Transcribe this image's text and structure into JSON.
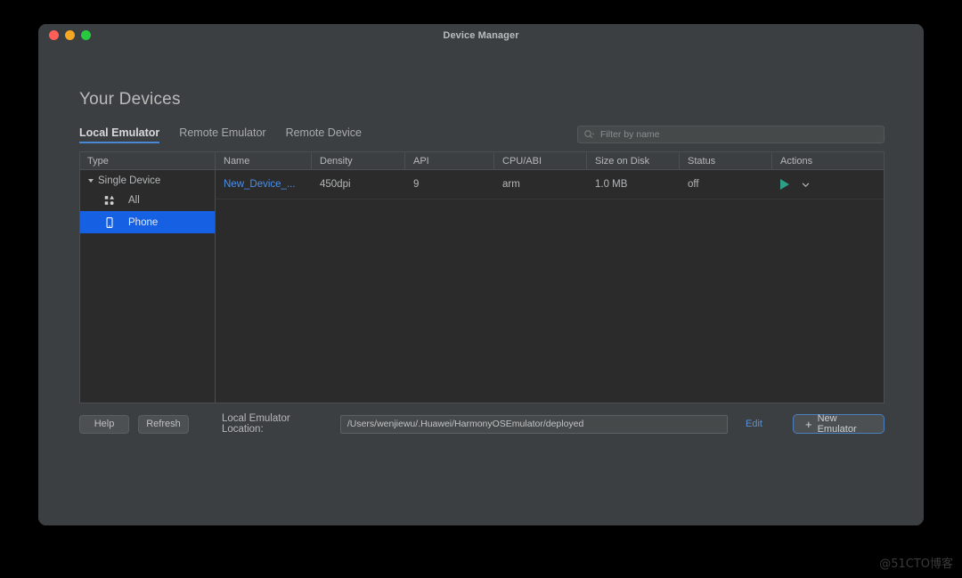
{
  "window": {
    "title": "Device Manager",
    "traffic_lights": [
      "close-red",
      "minimize-yellow",
      "maximize-green"
    ]
  },
  "page": {
    "heading": "Your Devices"
  },
  "tabs": [
    {
      "label": "Local Emulator",
      "active": true
    },
    {
      "label": "Remote Emulator",
      "active": false
    },
    {
      "label": "Remote Device",
      "active": false
    }
  ],
  "search": {
    "placeholder": "Filter by name",
    "value": "",
    "icon": "search-icon"
  },
  "tree": {
    "header": "Type",
    "group": {
      "label": "Single Device",
      "expanded": true
    },
    "items": [
      {
        "label": "All",
        "icon": "grid-icon",
        "selected": false
      },
      {
        "label": "Phone",
        "icon": "phone-icon",
        "selected": true
      }
    ]
  },
  "table": {
    "columns": [
      "Name",
      "Density",
      "API",
      "CPU/ABI",
      "Size on Disk",
      "Status",
      "Actions"
    ],
    "rows": [
      {
        "name": "New_Device_...",
        "density": "450dpi",
        "api": "9",
        "cpu_abi": "arm",
        "size_on_disk": "1.0 MB",
        "status": "off",
        "actions": [
          "play-icon",
          "chevron-down-icon"
        ]
      }
    ]
  },
  "bottom": {
    "help_label": "Help",
    "refresh_label": "Refresh",
    "location_label": "Local Emulator Location:",
    "location_value": "/Users/wenjiewu/.Huawei/HarmonyOSEmulator/deployed",
    "edit_label": "Edit",
    "new_emulator_label": "New Emulator",
    "new_emulator_plus": "+"
  },
  "watermark": "@51CTO博客",
  "colors": {
    "window_bg": "#3c3f41",
    "panel_bg": "#2b2b2b",
    "selection_blue": "#1661e3",
    "link_blue": "#4e8fe8",
    "accent_underline": "#4a88d6",
    "play_green": "#2f9e87",
    "button_border_blue": "#4a7fc1"
  }
}
